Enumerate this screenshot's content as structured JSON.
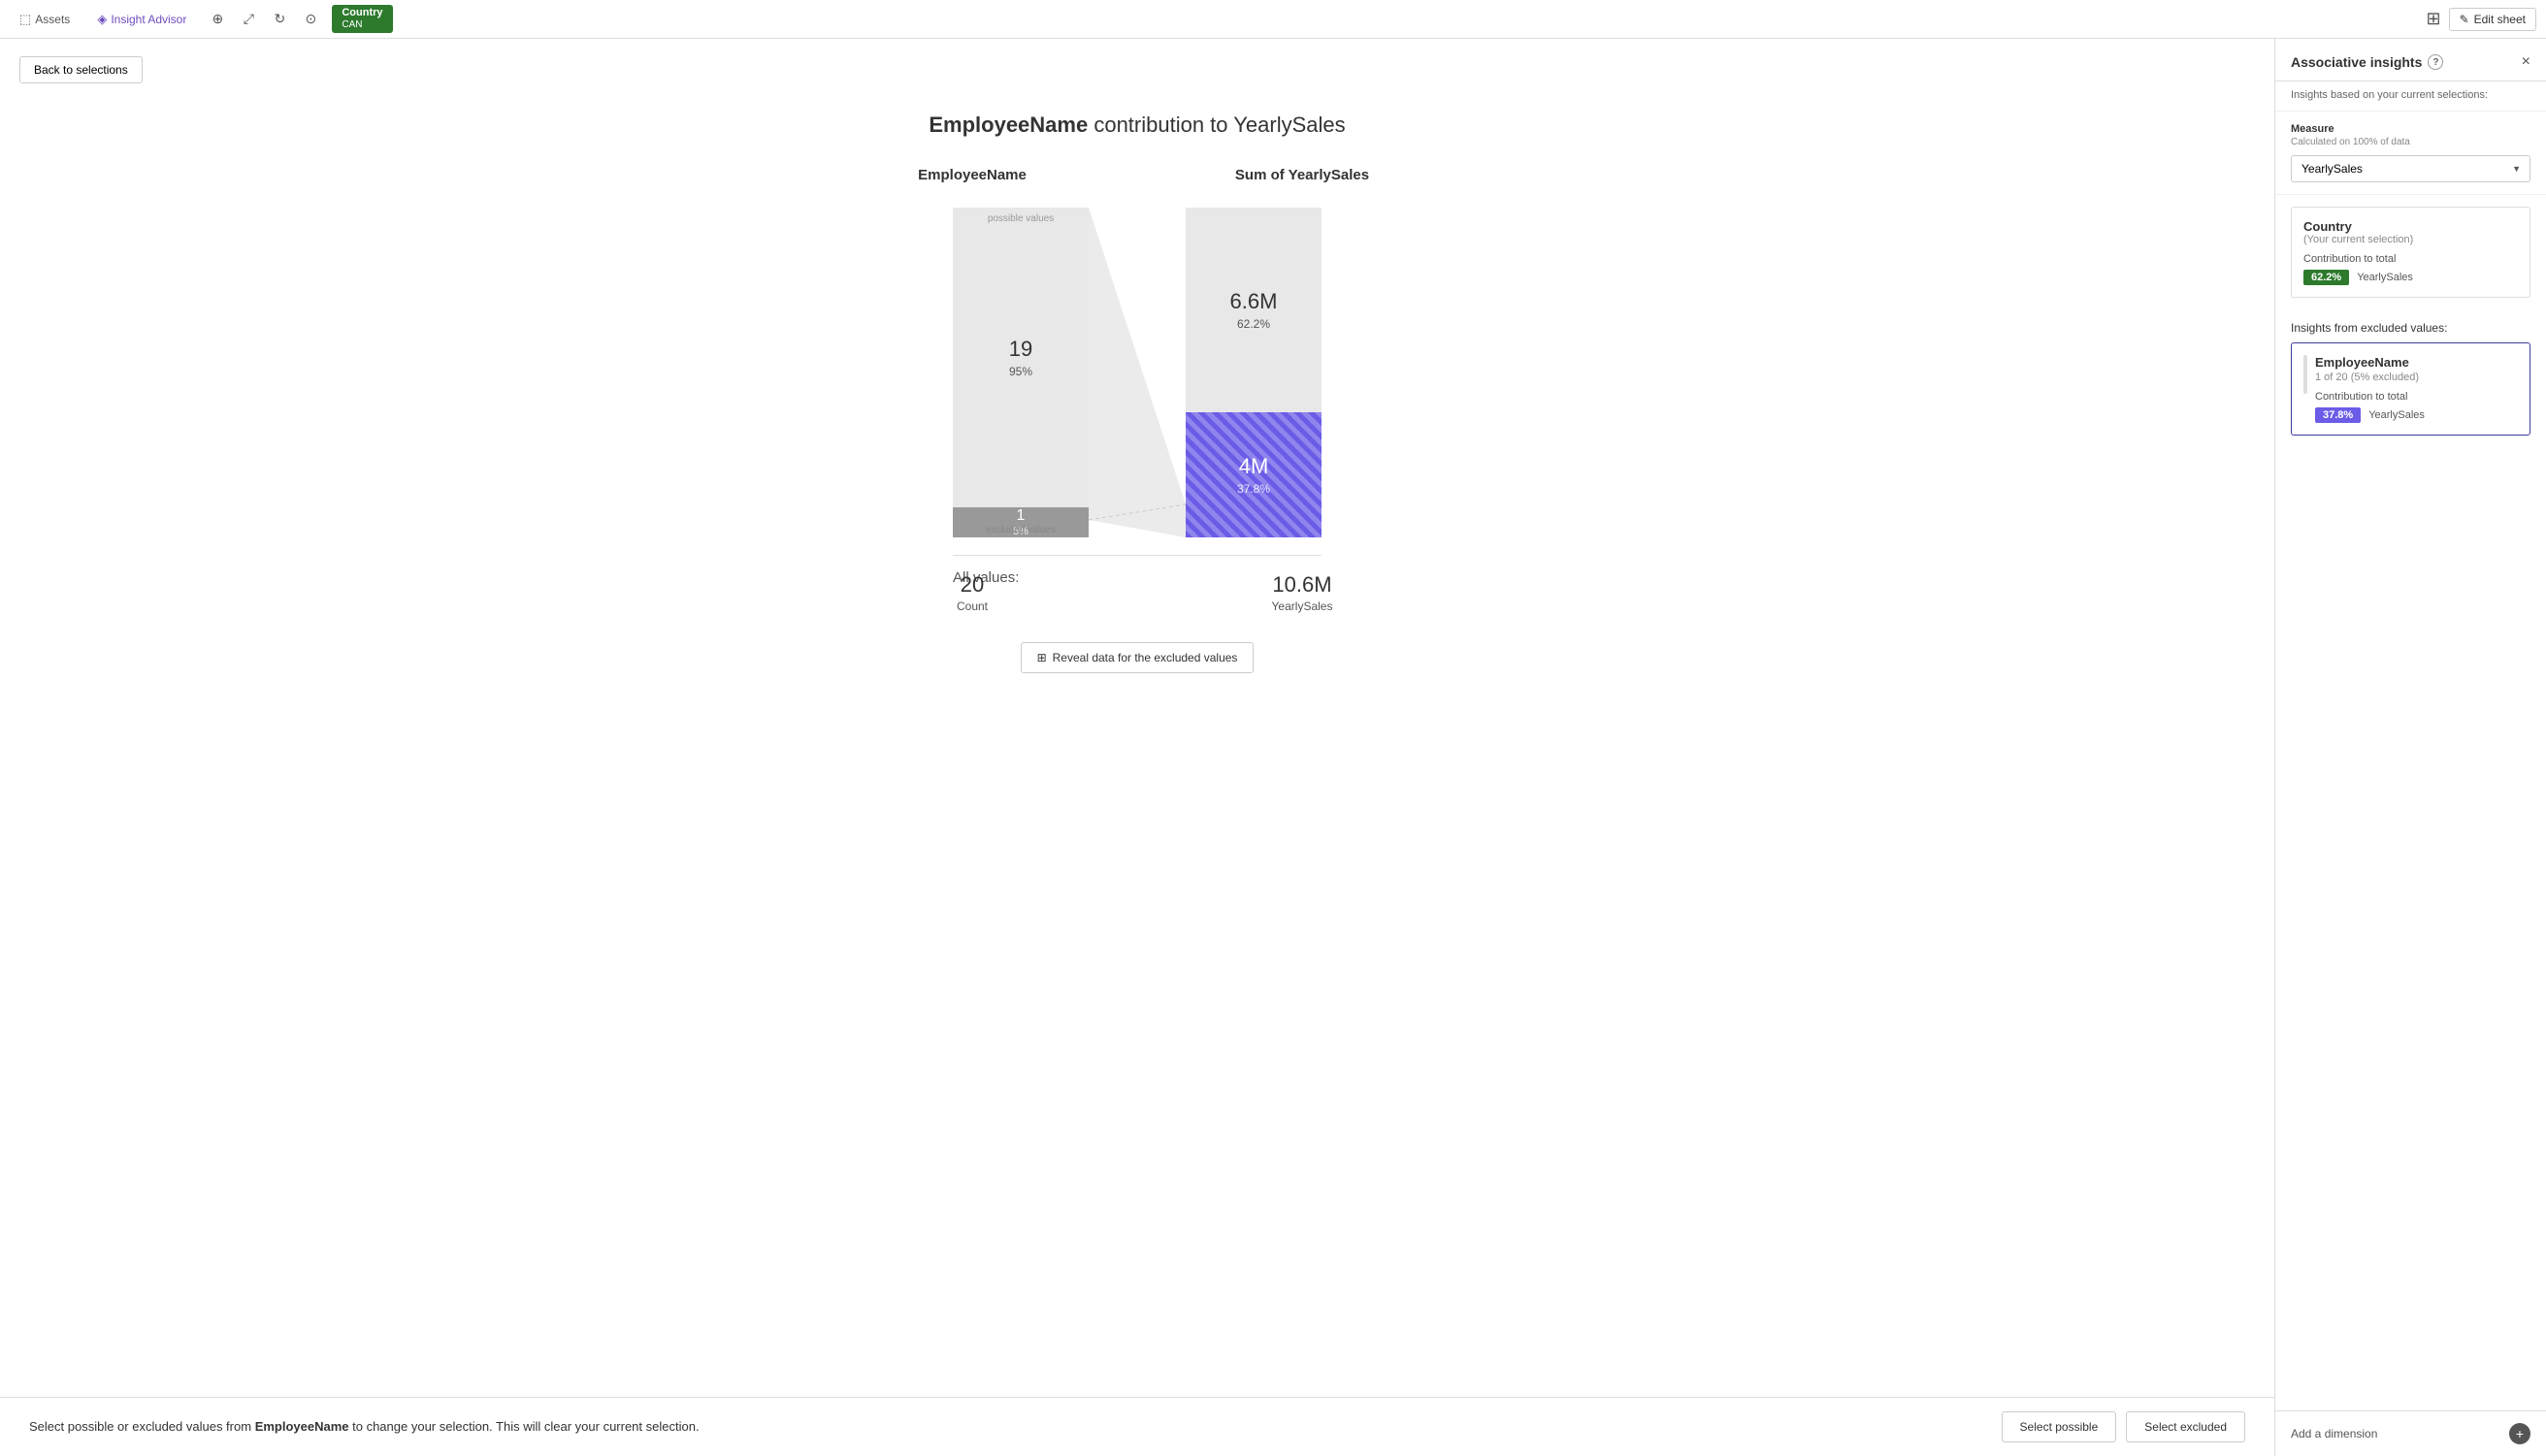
{
  "topBar": {
    "assetsLabel": "Assets",
    "insightLabel": "Insight Advisor",
    "countryLabel": "Country",
    "countryValue": "CAN",
    "editSheetLabel": "Edit sheet",
    "toolbarIcons": [
      "zoom-in",
      "expand",
      "rotate",
      "target"
    ]
  },
  "backButton": {
    "label": "Back to selections"
  },
  "chartTitle": {
    "boldPart": "EmployeeName",
    "middlePart": " contribution to ",
    "endPart": "YearlySales"
  },
  "chart": {
    "leftHeader": "EmployeeName",
    "rightHeader": "Sum of YearlySales",
    "possibleLabel": "possible values",
    "excludedLabel": "excluded values",
    "possibleCount": "19",
    "possiblePct": "95%",
    "excludedCount": "1",
    "excludedPct": "5%",
    "salesPossibleValue": "6.6M",
    "salesPossiblePct": "62.2%",
    "salesExcludedValue": "4M",
    "salesExcludedPct": "37.8%"
  },
  "allValues": {
    "label": "All values:",
    "countNum": "20",
    "countLabel": "Count",
    "salesNum": "10.6M",
    "salesLabel": "YearlySales"
  },
  "revealBtn": {
    "label": "Reveal data for the excluded values"
  },
  "bottomBar": {
    "text": "Select possible or excluded values from ",
    "boldField": "EmployeeName",
    "textEnd": " to change your selection. This will clear your current selection.",
    "selectPossibleLabel": "Select possible",
    "selectExcludedLabel": "Select excluded"
  },
  "rightPanel": {
    "title": "Associative insights",
    "subtitle": "Insights based on your current selections:",
    "closeIcon": "×",
    "helpIcon": "?",
    "measure": {
      "label": "Measure",
      "calcNote": "Calculated on 100% of data",
      "selectedValue": "YearlySales",
      "options": [
        "YearlySales"
      ]
    },
    "countryCard": {
      "title": "Country",
      "subtitle": "(Your current selection)",
      "contributionLabel": "Contribution to total",
      "pct": "62.2%",
      "field": "YearlySales"
    },
    "insightsFromExcluded": "Insights from excluded values:",
    "excludedCard": {
      "title": "EmployeeName",
      "subtitle": "1 of 20 (5% excluded)",
      "contributionLabel": "Contribution to total",
      "pct": "37.8%",
      "field": "YearlySales"
    },
    "addDimension": {
      "label": "Add a dimension",
      "plusIcon": "+"
    }
  }
}
